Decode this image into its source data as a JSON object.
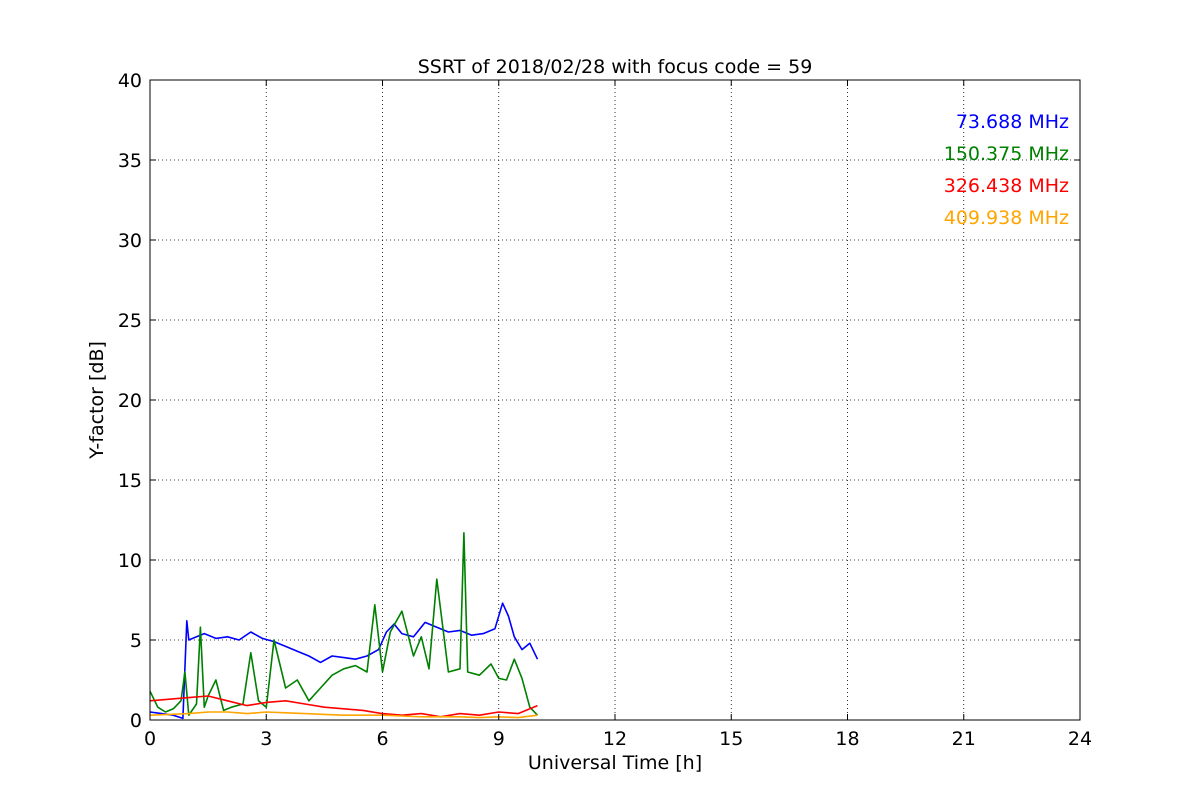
{
  "chart_data": {
    "type": "line",
    "title": "SSRT of 2018/02/28 with focus code = 59",
    "xlabel": "Universal Time [h]",
    "ylabel": "Y-factor [dB]",
    "xlim": [
      0,
      24
    ],
    "ylim": [
      0,
      40
    ],
    "xticks": [
      0,
      3,
      6,
      9,
      12,
      15,
      18,
      21,
      24
    ],
    "yticks": [
      0,
      5,
      10,
      15,
      20,
      25,
      30,
      35,
      40
    ],
    "grid": true,
    "legend_placement": "top-right",
    "series": [
      {
        "name": "73.688 MHz",
        "color": "#0000ff",
        "x": [
          0.0,
          0.3,
          0.6,
          0.85,
          0.95,
          1.0,
          1.2,
          1.4,
          1.7,
          2.0,
          2.3,
          2.6,
          2.9,
          3.2,
          3.5,
          3.8,
          4.1,
          4.4,
          4.7,
          5.0,
          5.3,
          5.6,
          5.9,
          6.1,
          6.3,
          6.5,
          6.8,
          7.1,
          7.4,
          7.7,
          8.0,
          8.3,
          8.6,
          8.9,
          9.1,
          9.25,
          9.4,
          9.6,
          9.8,
          10.0
        ],
        "y": [
          0.5,
          0.4,
          0.3,
          0.1,
          6.2,
          5.0,
          5.2,
          5.4,
          5.1,
          5.2,
          5.0,
          5.5,
          5.1,
          4.9,
          4.6,
          4.3,
          4.0,
          3.6,
          4.0,
          3.9,
          3.8,
          4.0,
          4.4,
          5.5,
          6.0,
          5.4,
          5.2,
          6.1,
          5.8,
          5.5,
          5.6,
          5.3,
          5.4,
          5.7,
          7.3,
          6.5,
          5.2,
          4.4,
          4.8,
          3.8
        ]
      },
      {
        "name": "150.375 MHz",
        "color": "#008000",
        "x": [
          0.0,
          0.2,
          0.4,
          0.6,
          0.8,
          0.9,
          1.0,
          1.2,
          1.3,
          1.4,
          1.5,
          1.7,
          1.9,
          2.1,
          2.4,
          2.6,
          2.8,
          3.0,
          3.2,
          3.5,
          3.8,
          4.1,
          4.4,
          4.7,
          5.0,
          5.3,
          5.6,
          5.8,
          6.0,
          6.2,
          6.5,
          6.8,
          7.0,
          7.2,
          7.4,
          7.7,
          8.0,
          8.1,
          8.2,
          8.5,
          8.8,
          9.0,
          9.2,
          9.4,
          9.6,
          9.8,
          10.0
        ],
        "y": [
          1.8,
          0.8,
          0.5,
          0.7,
          1.2,
          3.0,
          0.3,
          1.0,
          5.8,
          0.8,
          1.5,
          2.5,
          0.6,
          0.8,
          1.0,
          4.2,
          1.2,
          0.8,
          5.0,
          2.0,
          2.5,
          1.2,
          2.0,
          2.8,
          3.2,
          3.4,
          3.0,
          7.2,
          3.0,
          5.5,
          6.8,
          4.0,
          5.2,
          3.2,
          8.8,
          3.0,
          3.2,
          11.7,
          3.0,
          2.8,
          3.5,
          2.6,
          2.5,
          3.8,
          2.6,
          0.8,
          0.3
        ]
      },
      {
        "name": "326.438 MHz",
        "color": "#ff0000",
        "x": [
          0.0,
          0.5,
          1.0,
          1.5,
          2.0,
          2.5,
          3.0,
          3.5,
          4.0,
          4.5,
          5.0,
          5.5,
          6.0,
          6.5,
          7.0,
          7.5,
          8.0,
          8.5,
          9.0,
          9.5,
          10.0
        ],
        "y": [
          1.2,
          1.3,
          1.4,
          1.5,
          1.2,
          0.9,
          1.1,
          1.2,
          1.0,
          0.8,
          0.7,
          0.6,
          0.4,
          0.3,
          0.4,
          0.2,
          0.4,
          0.3,
          0.5,
          0.4,
          0.9
        ]
      },
      {
        "name": "409.938 MHz",
        "color": "#ffa500",
        "x": [
          0.0,
          0.5,
          1.0,
          1.5,
          2.0,
          2.5,
          3.0,
          3.5,
          4.0,
          4.5,
          5.0,
          5.5,
          6.0,
          6.5,
          7.0,
          7.5,
          8.0,
          8.5,
          9.0,
          9.5,
          10.0
        ],
        "y": [
          0.3,
          0.35,
          0.4,
          0.5,
          0.5,
          0.4,
          0.5,
          0.45,
          0.4,
          0.35,
          0.3,
          0.3,
          0.3,
          0.25,
          0.2,
          0.2,
          0.2,
          0.15,
          0.2,
          0.15,
          0.3
        ]
      }
    ]
  }
}
